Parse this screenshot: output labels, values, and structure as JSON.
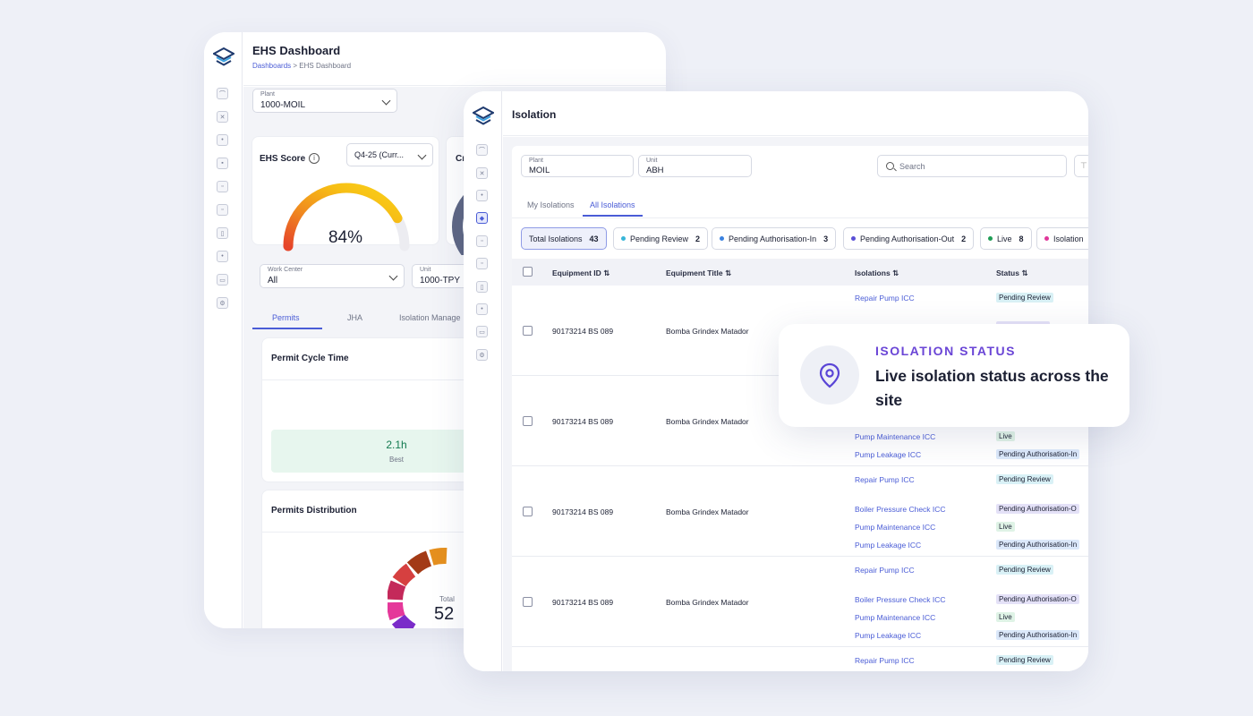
{
  "back": {
    "title": "EHS Dashboard",
    "breadcrumb": {
      "root": "Dashboards",
      "sep": ">",
      "current": "EHS Dashboard"
    },
    "plant": {
      "label": "Plant",
      "value": "1000-MOIL"
    },
    "ehs_score": {
      "title": "EHS Score",
      "period": "Q4-25 (Curr...",
      "value": "84%",
      "fraction": 0.84
    },
    "work_center": {
      "label": "Work Center",
      "value": "All"
    },
    "unit": {
      "label": "Unit",
      "value": "1000-TPY"
    },
    "tabs": [
      "Permits",
      "JHA",
      "Isolation Manage"
    ],
    "permit_cycle": {
      "title": "Permit Cycle Time",
      "best_value": "2.1h",
      "best_label": "Best"
    },
    "permits_distribution": {
      "title": "Permits Distribution",
      "total_label": "Total",
      "total_value": "52"
    }
  },
  "front": {
    "title": "Isolation",
    "plant": {
      "label": "Plant",
      "value": "MOIL"
    },
    "unit": {
      "label": "Unit",
      "value": "ABH"
    },
    "search_placeholder": "Search",
    "tabs": [
      "My Isolations",
      "All Isolations"
    ],
    "chips": [
      {
        "label": "Total Isolations",
        "count": "43",
        "color": ""
      },
      {
        "label": "Pending Review",
        "count": "2",
        "color": "#38b6d8"
      },
      {
        "label": "Pending Authorisation-In",
        "count": "3",
        "color": "#3b82e0"
      },
      {
        "label": "Pending Authorisation-Out",
        "count": "2",
        "color": "#5a4fd6"
      },
      {
        "label": "Live",
        "count": "8",
        "color": "#1f9d55"
      },
      {
        "label": "Isolation",
        "count": "",
        "color": "#e0379a"
      }
    ],
    "columns": [
      "Equipment ID",
      "Equipment Title",
      "Isolations",
      "Status"
    ],
    "rows": [
      {
        "id": "90173214 BS 089",
        "title": "Bomba Grindex Matador"
      },
      {
        "id": "90173214 BS 089",
        "title": "Bomba Grindex Matador"
      },
      {
        "id": "90173214 BS 089",
        "title": "Bomba Grindex Matador"
      },
      {
        "id": "90173214 BS 089",
        "title": "Bomba Grindex Matador"
      }
    ],
    "isolation_items": {
      "repair": "Repair Pump ICC",
      "boiler": "Boiler Pressure Check ICC",
      "maintenance": "Pump Maintenance ICC",
      "leakage": "Pump Leakage ICC"
    },
    "statuses": {
      "review": "Pending Review",
      "auth_out": "Pending Authorisation-O",
      "live": "Live",
      "auth_in": "Pending Authorisation-In"
    }
  },
  "callout": {
    "kicker": "ISOLATION STATUS",
    "headline": "Live isolation status across the site"
  },
  "colors": {
    "accent": "#4a5cd6",
    "kicker": "#6a45d6",
    "review_badge": "#d9f1f6",
    "auth_in_badge": "#dbe8fa",
    "auth_out_badge": "#e4e1f7",
    "live_badge": "#dff3e6"
  }
}
